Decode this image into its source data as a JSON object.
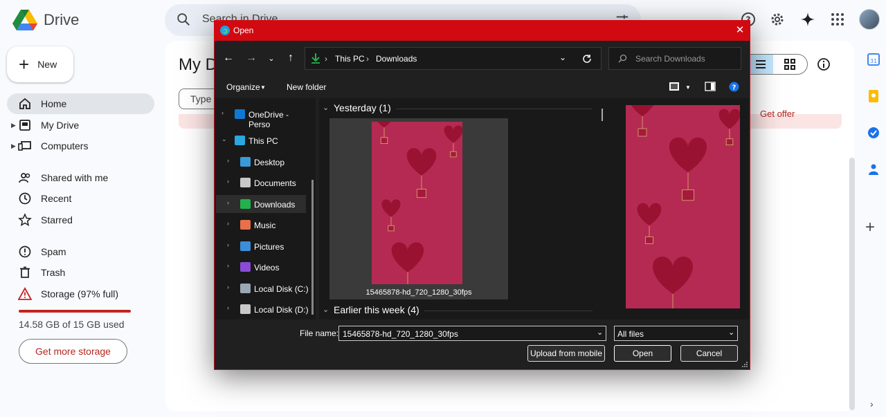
{
  "app": {
    "name": "Drive"
  },
  "search": {
    "placeholder": "Search in Drive"
  },
  "nav": {
    "new_label": "New",
    "items": [
      {
        "label": "Home",
        "active": true
      },
      {
        "label": "My Drive"
      },
      {
        "label": "Computers"
      },
      {
        "label": "Shared with me"
      },
      {
        "label": "Recent"
      },
      {
        "label": "Starred"
      },
      {
        "label": "Spam"
      },
      {
        "label": "Trash"
      },
      {
        "label": "Storage (97% full)"
      }
    ],
    "storage_used": "14.58 GB of 15 GB used",
    "storage_fraction": 0.97,
    "get_storage": "Get more storage"
  },
  "main": {
    "title": "My D",
    "type_chip": "Type",
    "banner_action": "Get offer"
  },
  "dialog": {
    "title": "Open",
    "breadcrumb": [
      "This PC",
      "Downloads"
    ],
    "search_placeholder": "Search Downloads",
    "toolbar": {
      "organize": "Organize",
      "new_folder": "New folder"
    },
    "tree": [
      {
        "label": "OneDrive - Perso",
        "color": "#0f78d4"
      },
      {
        "label": "This PC",
        "color": "#2aa7e0"
      },
      {
        "label": "Desktop",
        "color": "#3a9ad9"
      },
      {
        "label": "Documents",
        "color": "#c8c8c8"
      },
      {
        "label": "Downloads",
        "color": "#22b14c"
      },
      {
        "label": "Music",
        "color": "#e8704b"
      },
      {
        "label": "Pictures",
        "color": "#3b8ed8"
      },
      {
        "label": "Videos",
        "color": "#8a4bd8"
      },
      {
        "label": "Local Disk (C:)",
        "color": "#9aa8b4"
      },
      {
        "label": "Local Disk (D:)",
        "color": "#c8c8c8"
      }
    ],
    "groups": {
      "yesterday": "Yesterday (1)",
      "earlier": "Earlier this week (4)"
    },
    "file_name": "15465878-hd_720_1280_30fps",
    "file_name_label": "File name:",
    "file_type": "All files",
    "buttons": {
      "upload": "Upload from mobile",
      "open": "Open",
      "cancel": "Cancel"
    }
  },
  "colors": {
    "titlebar": "#d10a12",
    "accent_red": "#c5221f",
    "thumb": "#b52a53"
  }
}
